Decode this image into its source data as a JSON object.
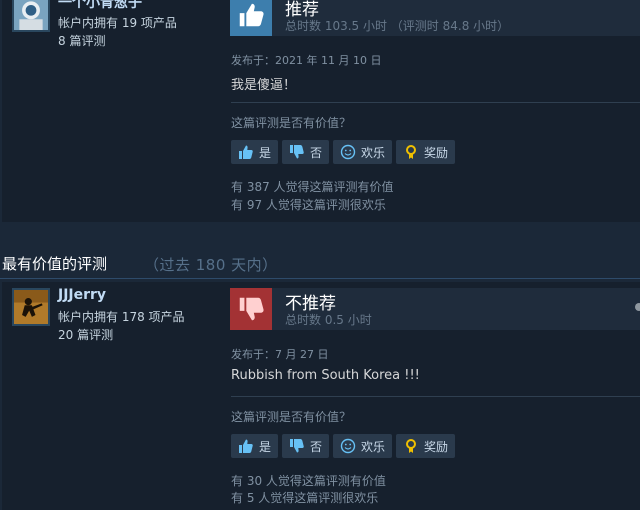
{
  "reviews": [
    {
      "persona": "一个小青葱子",
      "owns": "帐户内拥有 19 项产品",
      "count": "8 篇评测",
      "recommend": "推荐",
      "hours": "总时数 103.5 小时  （评测时 84.8 小时）",
      "posted": "发布于：2021 年 11 月 10 日",
      "content": "我是傻逼！",
      "helpful_q": "这篇评测是否有价值？",
      "buttons": {
        "yes": "是",
        "no": "否",
        "funny": "欢乐",
        "award": "奖励"
      },
      "stat1": "有 387 人觉得这篇评测有价值",
      "stat2": "有 97 人觉得这篇评测很欢乐",
      "vote": "up"
    },
    {
      "persona": "JJJerry",
      "owns": "帐户内拥有 178 项产品",
      "count": "20 篇评测",
      "recommend": "不推荐",
      "hours": "总时数 0.5 小时",
      "posted": "发布于：7 月 27 日",
      "content": "Rubbish from South Korea !!!",
      "helpful_q": "这篇评测是否有价值？",
      "buttons": {
        "yes": "是",
        "no": "否",
        "funny": "欢乐",
        "award": "奖励"
      },
      "stat1": "有 30 人觉得这篇评测有价值",
      "stat2": "有 5 人觉得这篇评测很欢乐",
      "vote": "down"
    }
  ],
  "section": {
    "title": "最有价值的评测",
    "subtitle": "（过去 180 天内）"
  },
  "colors": {
    "background": "#1b2838",
    "card": "#16202d",
    "thumb_up": "#3d7ead",
    "thumb_down": "#a33234",
    "award": "#f0c000"
  }
}
